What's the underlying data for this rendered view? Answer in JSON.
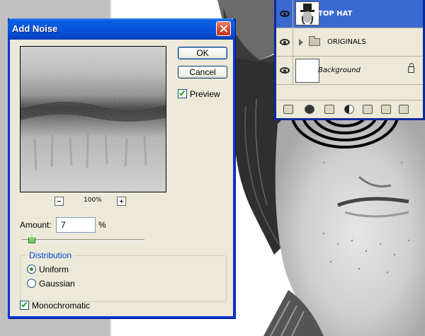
{
  "dialog": {
    "title": "Add Noise",
    "ok_label": "OK",
    "cancel_label": "Cancel",
    "preview_label": "Preview",
    "preview_checked": true,
    "zoom_value": "100%",
    "amount_label": "Amount:",
    "amount_value": "7",
    "amount_unit": "%",
    "distribution_label": "Distribution",
    "uniform_label": "Uniform",
    "gaussian_label": "Gaussian",
    "selected_distribution": "Uniform",
    "monochromatic_label": "Monochromatic",
    "monochromatic_checked": true
  },
  "layers_panel": {
    "layers": [
      {
        "name": "TOP HAT",
        "selected": true,
        "visible": true
      },
      {
        "name": "ORIGINALS",
        "type": "group",
        "visible": true
      },
      {
        "name": "Background",
        "locked": true,
        "visible": true
      }
    ]
  },
  "colors": {
    "title_bar": "#0855dd",
    "dialog_bg": "#ece9d8",
    "selected_layer": "#3a6ad1",
    "group_title": "#0046d5"
  }
}
